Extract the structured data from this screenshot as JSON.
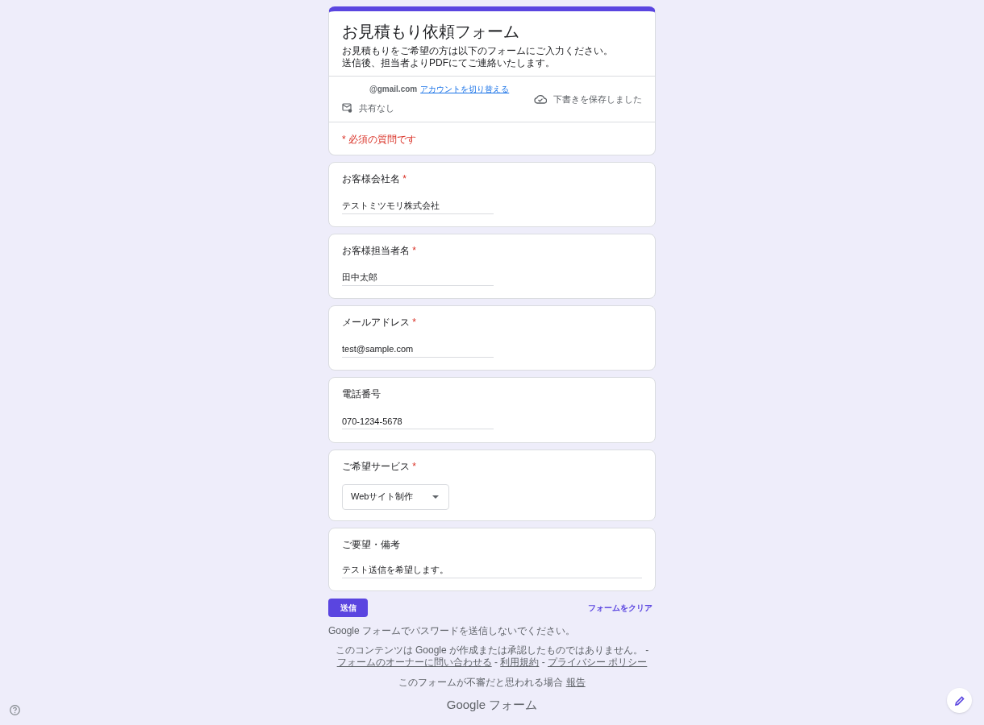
{
  "header": {
    "title": "お見積もり依頼フォーム",
    "description": [
      "お見積もりをご希望の方は以下のフォームにご入力ください。",
      "送信後、担当者よりPDFにてご連絡いたします。"
    ],
    "account": "@gmail.com",
    "switch_account": "アカウントを切り替える",
    "sharing": "共有なし",
    "draft_status": "下書きを保存しました",
    "required_note": "* 必須の質問です"
  },
  "questions": [
    {
      "kind": "text",
      "label": "お客様会社名",
      "required": true,
      "value": "テストミツモリ株式会社"
    },
    {
      "kind": "text",
      "label": "お客様担当者名",
      "required": true,
      "value": "田中太郎"
    },
    {
      "kind": "text",
      "label": "メールアドレス",
      "required": true,
      "value": "test@sample.com"
    },
    {
      "kind": "text",
      "label": "電話番号",
      "required": false,
      "value": "070-1234-5678"
    },
    {
      "kind": "select",
      "label": "ご希望サービス",
      "required": true,
      "value": "Webサイト制作"
    },
    {
      "kind": "textarea",
      "label": "ご要望・備考",
      "required": false,
      "value": "テスト送信を希望します。"
    }
  ],
  "required_mark": "*",
  "submit": "送信",
  "clear": "フォームをクリア",
  "footer": {
    "password_warning": "Google フォームでパスワードを送信しないでください。",
    "disclaimer": "このコンテンツは Google が作成または承認したものではありません。 - ",
    "contact_owner": "フォームのオーナーに問い合わせる",
    "sep1": " - ",
    "terms": "利用規約",
    "sep2": " - ",
    "privacy": "プライバシー ポリシー",
    "report_prefix": "このフォームが不審だと思われる場合 ",
    "report": "報告",
    "brand_google": "Google",
    "brand_forms": "フォーム"
  }
}
